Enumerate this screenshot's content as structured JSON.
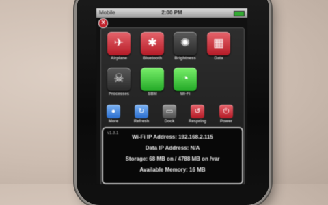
{
  "status_bar": {
    "carrier": "Mobile",
    "time": "2:00 PM"
  },
  "close_label": "×",
  "toggles": [
    {
      "label": "Airplane",
      "glyph": "✈"
    },
    {
      "label": "Bluetooth",
      "glyph": "✱"
    },
    {
      "label": "Brightness",
      "glyph": "✺"
    },
    {
      "label": "Data",
      "glyph": "▦"
    },
    {
      "label": "Processes",
      "glyph": "☠"
    },
    {
      "label": "SBM",
      "glyph": ""
    },
    {
      "label": "Wi-Fi",
      "glyph": "◔"
    }
  ],
  "actions": [
    {
      "label": "More",
      "glyph": "●"
    },
    {
      "label": "Refresh",
      "glyph": "↻"
    },
    {
      "label": "Dock",
      "glyph": "▭"
    },
    {
      "label": "Respring",
      "glyph": "↺"
    },
    {
      "label": "Power",
      "glyph": "⏻"
    }
  ],
  "info": {
    "version": "v1.3.1",
    "wifi_ip": "Wi-Fi IP Address: 192.168.2.115",
    "data_ip": "Data IP Address: N/A",
    "storage": "Storage: 68 MB on / 4788 MB on /var",
    "memory": "Available Memory: 16 MB"
  }
}
